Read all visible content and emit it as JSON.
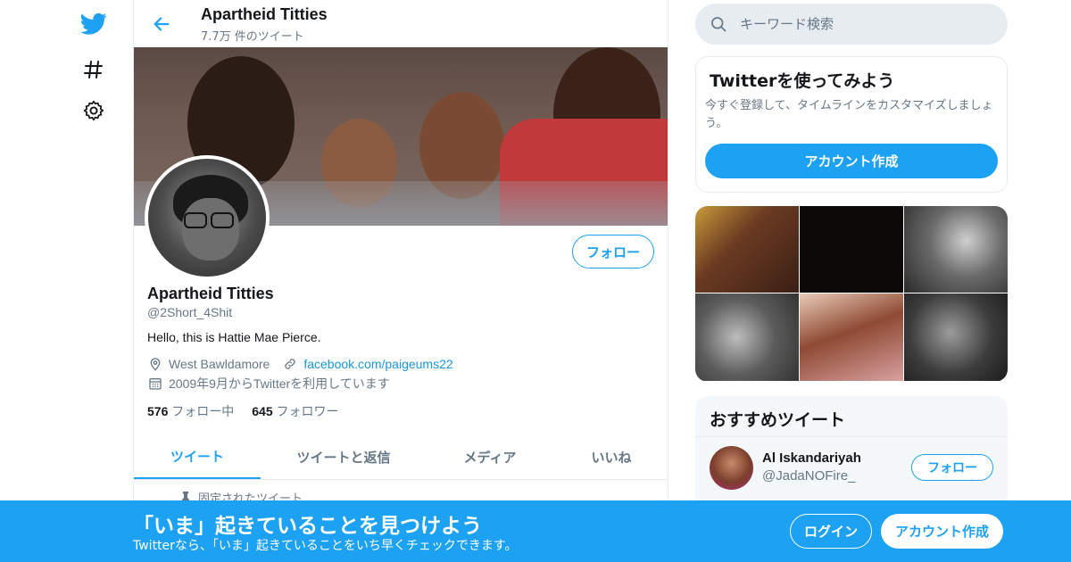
{
  "colors": {
    "accent": "#1da1f2",
    "secondary_text": "#657786",
    "border": "#e6ecf0"
  },
  "nav": {
    "icons": [
      "twitter-logo-icon",
      "hashtag-icon",
      "gear-icon"
    ]
  },
  "header": {
    "name": "Apartheid Titties",
    "tweet_count": "7.7万 件のツイート"
  },
  "profile": {
    "follow_label": "フォロー",
    "name": "Apartheid Titties",
    "handle": "@2Short_4Shit",
    "bio": "Hello, this is Hattie Mae Pierce.",
    "location": "West Bawldamore",
    "website": "facebook.com/paigeums22",
    "joined": "2009年9月からTwitterを利用しています",
    "following_count": "576",
    "following_label": "フォロー中",
    "followers_count": "645",
    "followers_label": "フォロワー"
  },
  "tabs": [
    "ツイート",
    "ツイートと返信",
    "メディア",
    "いいね"
  ],
  "pinned_label": "固定されたツイート",
  "search": {
    "placeholder": "キーワード検索"
  },
  "signup_card": {
    "title": "Twitterを使ってみよう",
    "subtitle": "今すぐ登録して、タイムラインをカスタマイズしましょう。",
    "button": "アカウント作成"
  },
  "recommended": {
    "title": "おすすめツイート",
    "user_name": "Al Iskandariyah",
    "user_handle": "@JadaNOFire_",
    "follow_label": "フォロー"
  },
  "bottom_bar": {
    "title": "「いま」起きていることを見つけよう",
    "subtitle": "Twitterなら、「いま」起きていることをいち早くチェックできます。",
    "login": "ログイン",
    "signup": "アカウント作成"
  }
}
